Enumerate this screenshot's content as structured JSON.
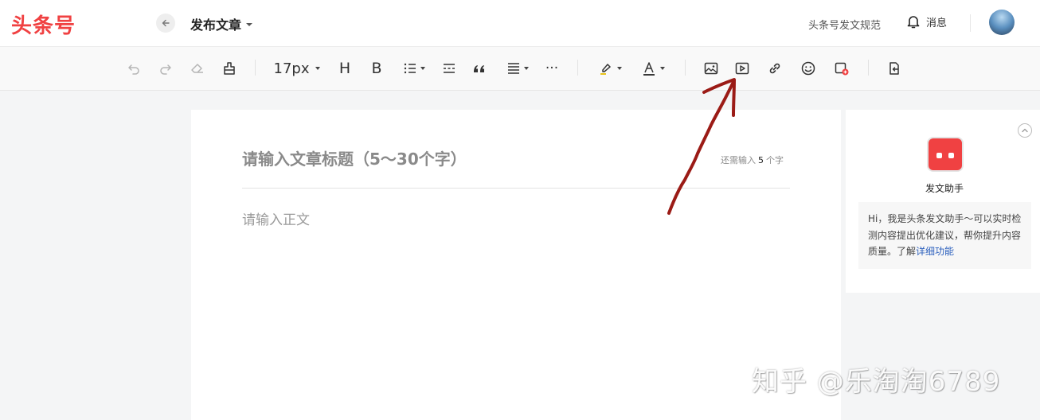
{
  "header": {
    "logo_text": "头条号",
    "page_title": "发布文章",
    "guide_link": "头条号发文规范",
    "notifications_label": "消息"
  },
  "toolbar": {
    "font_size": "17px",
    "heading_label": "H",
    "bold_label": "B",
    "more_label": "···"
  },
  "editor": {
    "title_placeholder": "请输入文章标题（5～30个字）",
    "remaining_prefix": "还需输入",
    "remaining_count": "5",
    "remaining_suffix": "个字",
    "body_placeholder": "请输入正文"
  },
  "assistant": {
    "name": "发文助手",
    "message": "Hi，我是头条发文助手～可以实时检测内容提出优化建议，帮你提升内容质量。了解",
    "link_text": "详细功能"
  },
  "watermark": {
    "text": "知乎 @乐淘淘6789"
  },
  "colors": {
    "brand_red": "#f04142",
    "link_blue": "#2b5fbd",
    "annotation_arrow": "#9b1b16"
  }
}
